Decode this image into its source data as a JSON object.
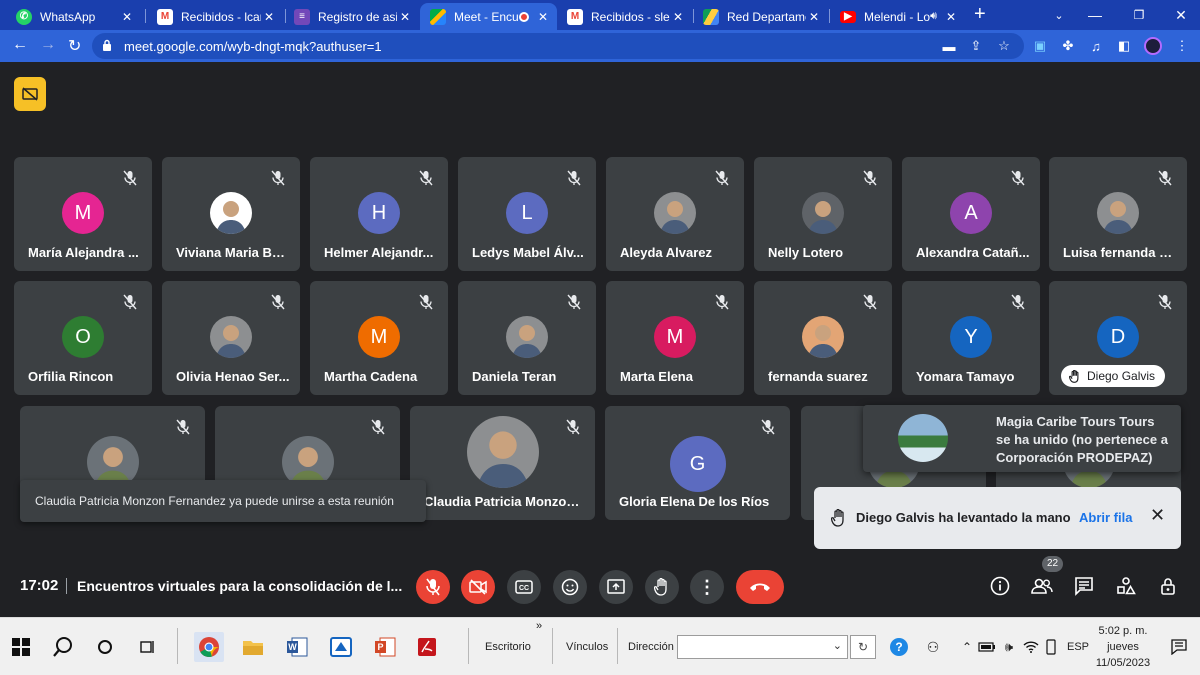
{
  "browser": {
    "tabs": [
      {
        "label": "WhatsApp",
        "color": "#25d366",
        "icon": "whatsapp-icon"
      },
      {
        "label": "Recibidos - lcarm",
        "color": "#ea4335",
        "icon": "gmail-icon"
      },
      {
        "label": "Registro de asiste",
        "color": "#7248b9",
        "icon": "forms-icon"
      },
      {
        "label": "Meet - Encue",
        "color": "#00897b",
        "icon": "meet-icon"
      },
      {
        "label": "Recibidos - sleidy",
        "color": "#ea4335",
        "icon": "gmail-icon"
      },
      {
        "label": "Red Departament",
        "color": "#34a853",
        "icon": "drive-icon"
      },
      {
        "label": "Melendi - Lo",
        "color": "#ff0000",
        "icon": "youtube-icon"
      }
    ],
    "tab_close": "✕",
    "new_tab": "+",
    "url": "meet.google.com/wyb-dngt-mqk?authuser=1"
  },
  "meet": {
    "tiles_row1": [
      {
        "name": "María Alejandra ...",
        "initial": "M",
        "color": "#e52592"
      },
      {
        "name": "Viviana Maria Bej...",
        "initial": "",
        "color": "#ffffff"
      },
      {
        "name": "Helmer Alejandr...",
        "initial": "H",
        "color": "#5c6bc0"
      },
      {
        "name": "Ledys Mabel Álv...",
        "initial": "L",
        "color": "#5c6bc0"
      },
      {
        "name": "Aleyda Alvarez",
        "initial": "",
        "color": "#8d8f91"
      },
      {
        "name": "Nelly Lotero",
        "initial": "",
        "color": "#5f6368"
      },
      {
        "name": "Alexandra Catañ...",
        "initial": "A",
        "color": "#8e44ad"
      },
      {
        "name": "Luisa fernanda G...",
        "initial": "",
        "color": "#8d8f91"
      }
    ],
    "tiles_row2": [
      {
        "name": "Orfilia Rincon",
        "initial": "O",
        "color": "#2e7d32"
      },
      {
        "name": "Olivia Henao Ser...",
        "initial": "",
        "color": "#8d8f91"
      },
      {
        "name": "Martha Cadena",
        "initial": "M",
        "color": "#ef6c00"
      },
      {
        "name": "Daniela Teran",
        "initial": "",
        "color": "#8d8f91"
      },
      {
        "name": "Marta Elena",
        "initial": "M",
        "color": "#d81b60"
      },
      {
        "name": "fernanda suarez",
        "initial": "",
        "color": "#e3a575"
      },
      {
        "name": "Yomara Tamayo",
        "initial": "Y",
        "color": "#1565c0"
      },
      {
        "name": "Diego Galvis",
        "initial": "D",
        "color": "#1565c0"
      }
    ],
    "tiles_row3": [
      {
        "name": "Claudia Patricia Monzon ...",
        "initial": "",
        "color": "#8d8f91"
      },
      {
        "name": "Gloria Elena De los Ríos",
        "initial": "G",
        "color": "#5c6bc0"
      }
    ],
    "join_toast": "Claudia Patricia Monzon Fernandez ya puede unirse a esta reunión",
    "joined_notice": "Magia Caribe Tours Tours se ha unido (no pertenece a Corporación PRODEPAZ)",
    "hand_notice": "Diego Galvis ha levantado la mano",
    "hand_action": "Abrir fila",
    "time": "17:02",
    "meeting_title": "Encuentros virtuales para la consolidación de l...",
    "people_count": "22"
  },
  "taskbar": {
    "escritorio": "Escritorio",
    "vinculos": "Vínculos",
    "direccion": "Dirección",
    "lang": "ESP",
    "clock_time": "5:02 p. m.",
    "clock_day": "jueves",
    "clock_date": "11/05/2023",
    "chevron": "»"
  }
}
